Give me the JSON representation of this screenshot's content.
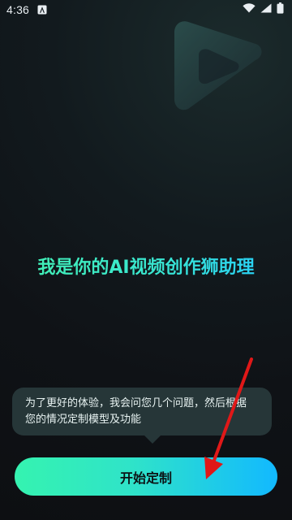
{
  "status_bar": {
    "time": "4:36",
    "left_icon": "a-notification-icon",
    "wifi_icon": "wifi-icon",
    "signal_icon": "signal-icon",
    "battery_icon": "battery-icon"
  },
  "hero": {
    "title": "我是你的AI视频创作狮助理"
  },
  "tooltip": {
    "line1": "为了更好的体验，我会问您几个问题，然后根据",
    "line2": "您的情况定制模型及功能"
  },
  "action": {
    "start_label": "开始定制"
  },
  "colors": {
    "gradient_start": "#35f3b0",
    "gradient_end": "#12b9ff",
    "bubble_bg": "#283a3c",
    "background": "#0f1216",
    "annotation_arrow": "#e01818"
  }
}
